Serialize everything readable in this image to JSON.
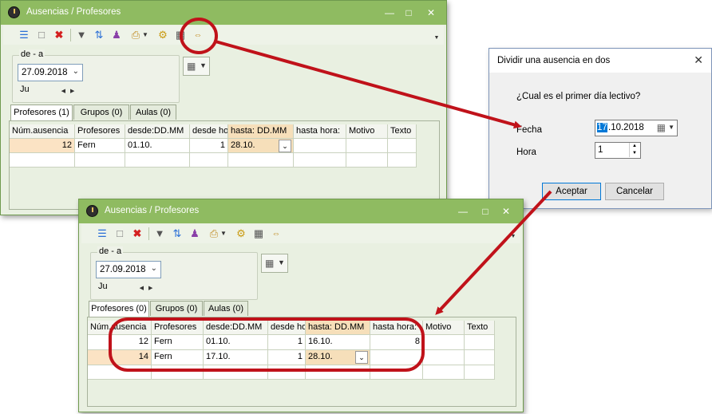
{
  "window1": {
    "title": "Ausencias / Profesores",
    "group_label": "de - a",
    "date": "27.09.2018",
    "day": "Ju",
    "tabs": [
      {
        "label": "Profesores (1)"
      },
      {
        "label": "Grupos (0)"
      },
      {
        "label": "Aulas (0)"
      }
    ],
    "columns": [
      "Núm.ausencia",
      "Profesores",
      "desde:DD.MM",
      "desde ho",
      "hasta: DD.MM",
      "hasta hora:",
      "Motivo",
      "Texto"
    ],
    "rows": [
      [
        "12",
        "Fern",
        "01.10.",
        "1",
        "28.10.",
        "",
        "",
        ""
      ]
    ]
  },
  "window2": {
    "title": "Ausencias / Profesores",
    "group_label": "de - a",
    "date": "27.09.2018",
    "day": "Ju",
    "tabs": [
      {
        "label": "Profesores (0)"
      },
      {
        "label": "Grupos (0)"
      },
      {
        "label": "Aulas (0)"
      }
    ],
    "columns": [
      "Núm.ausencia",
      "Profesores",
      "desde:DD.MM",
      "desde ho",
      "hasta: DD.MM",
      "hasta hora:",
      "Motivo",
      "Texto"
    ],
    "rows": [
      [
        "12",
        "Fern",
        "01.10.",
        "1",
        "16.10.",
        "8",
        "",
        ""
      ],
      [
        "14",
        "Fern",
        "17.10.",
        "1",
        "28.10.",
        "",
        "",
        ""
      ]
    ]
  },
  "dialog": {
    "title": "Dividir una ausencia en dos",
    "question": "¿Cual es el primer día lectivo?",
    "fecha_label": "Fecha",
    "fecha_sel": "17",
    "fecha_rest": ".10.2018",
    "hora_label": "Hora",
    "hora_value": "1",
    "accept_label": "Aceptar",
    "cancel_label": "Cancelar"
  },
  "colors": {
    "titlebar": "#8fbb61",
    "window_bg": "#e9f0e1",
    "highlight_ring": "#c0121a",
    "selected_cell": "#f6dfba"
  }
}
